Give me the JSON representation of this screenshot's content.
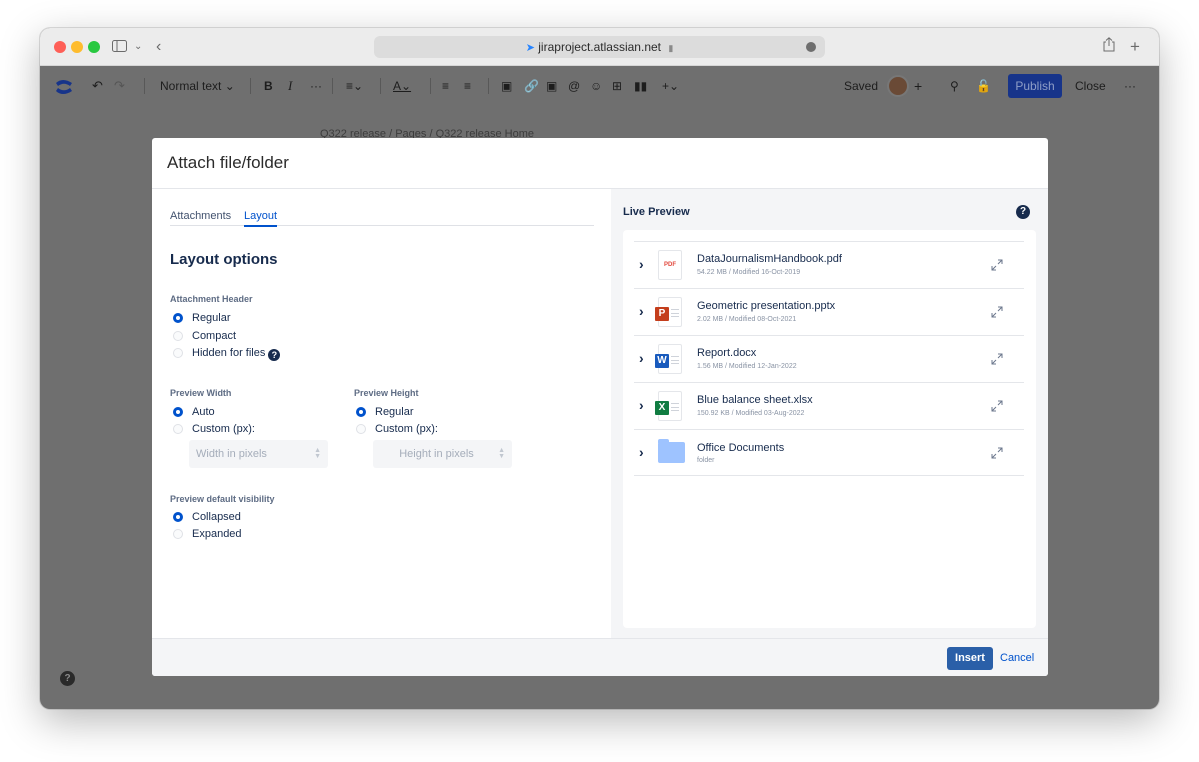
{
  "browser": {
    "url": "jiraproject.atlassian.net"
  },
  "editor_toolbar": {
    "text_style": "Normal text",
    "bold": "B",
    "italic": "I",
    "more": "···",
    "saved": "Saved",
    "publish": "Publish",
    "close": "Close",
    "overflow": "···"
  },
  "page": {
    "breadcrumb": "Q322 release  /  Pages  /  Q322 release Home"
  },
  "dialog": {
    "title": "Attach file/folder",
    "tabs": [
      {
        "label": "Attachments",
        "active": false
      },
      {
        "label": "Layout",
        "active": true
      }
    ],
    "layout_options": {
      "title": "Layout options",
      "attachment_header": {
        "label": "Attachment Header",
        "options": [
          "Regular",
          "Compact",
          "Hidden for files"
        ],
        "selected": "Regular"
      },
      "preview_width": {
        "label": "Preview Width",
        "options": [
          "Auto",
          "Custom (px):"
        ],
        "selected": "Auto",
        "placeholder": "Width in pixels"
      },
      "preview_height": {
        "label": "Preview Height",
        "options": [
          "Regular",
          "Custom (px):"
        ],
        "selected": "Regular",
        "placeholder": "Height in pixels"
      },
      "preview_visibility": {
        "label": "Preview default visibility",
        "options": [
          "Collapsed",
          "Expanded"
        ],
        "selected": "Collapsed"
      }
    },
    "live_preview": {
      "title": "Live Preview",
      "files": [
        {
          "name": "DataJournalismHandbook.pdf",
          "meta": "54.22 MB / Modified 16-Oct-2019",
          "icon": "pdf-icon",
          "badge": "PDF",
          "color": "#e2483d"
        },
        {
          "name": "Geometric presentation.pptx",
          "meta": "2.02 MB / Modified 08-Oct-2021",
          "icon": "powerpoint-icon",
          "badge": "P",
          "color": "#c43e1c"
        },
        {
          "name": "Report.docx",
          "meta": "1.56 MB / Modified 12-Jan-2022",
          "icon": "word-icon",
          "badge": "W",
          "color": "#185abd"
        },
        {
          "name": "Blue balance sheet.xlsx",
          "meta": "150.92 KB / Modified 03-Aug-2022",
          "icon": "excel-icon",
          "badge": "X",
          "color": "#107c41"
        },
        {
          "name": "Office Documents",
          "meta": "folder",
          "icon": "folder-icon",
          "badge": "",
          "color": "#9ec3ff"
        }
      ]
    },
    "footer": {
      "insert": "Insert",
      "cancel": "Cancel"
    }
  },
  "colors": {
    "accent": "#0052cc",
    "publish": "#17348a",
    "insert": "#2a5fa8"
  }
}
